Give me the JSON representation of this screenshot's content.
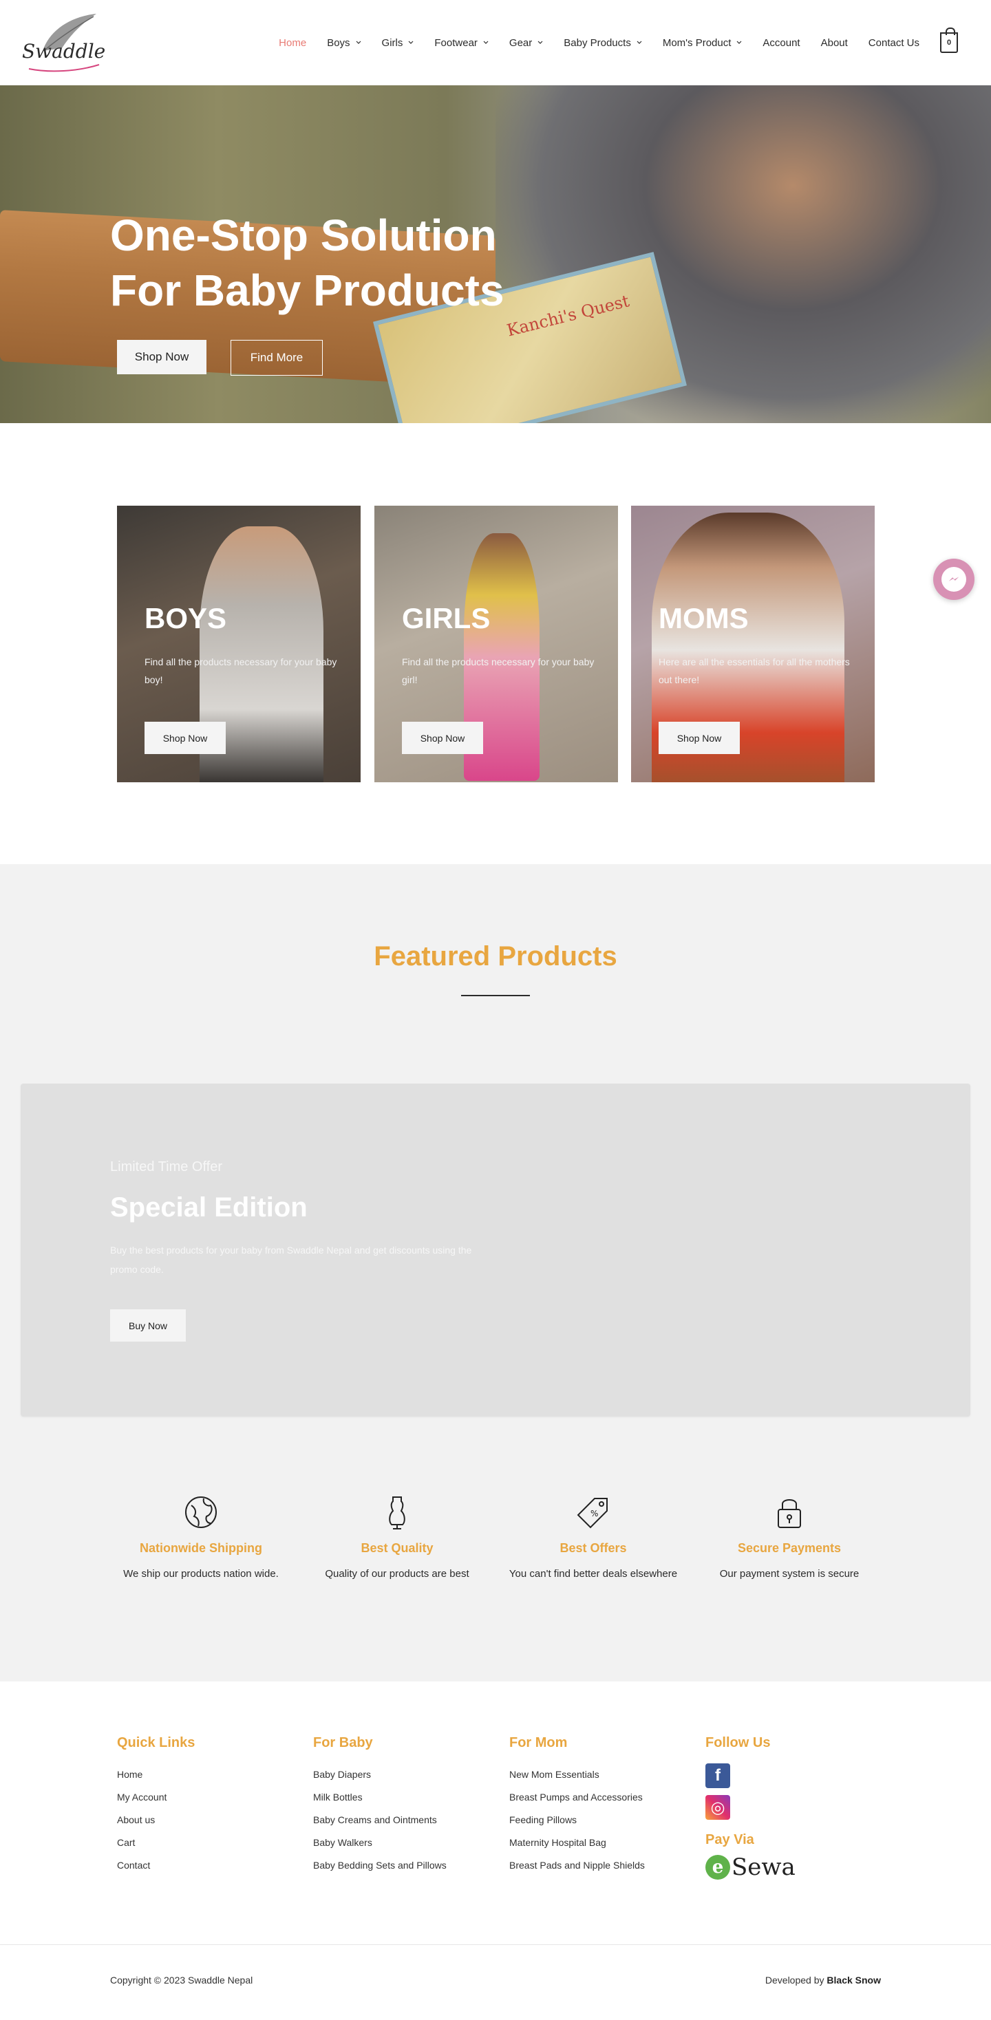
{
  "brand": {
    "logo_text": "Swaddle"
  },
  "nav": {
    "items": [
      {
        "label": "Home",
        "active": true,
        "dropdown": false
      },
      {
        "label": "Boys",
        "dropdown": true
      },
      {
        "label": "Girls",
        "dropdown": true
      },
      {
        "label": "Footwear",
        "dropdown": true
      },
      {
        "label": "Gear",
        "dropdown": true
      },
      {
        "label": "Baby Products",
        "dropdown": true
      },
      {
        "label": "Mom's Product",
        "dropdown": true
      },
      {
        "label": "Account",
        "dropdown": false
      },
      {
        "label": "About",
        "dropdown": false
      },
      {
        "label": "Contact Us",
        "dropdown": false
      }
    ],
    "cart_count": "0"
  },
  "hero": {
    "title_line1": "One-Stop Solution",
    "title_line2": "For Baby Products",
    "book_title": "Kanchi's Quest",
    "shop_button": "Shop Now",
    "find_button": "Find More"
  },
  "categories": [
    {
      "title": "BOYS",
      "desc": "Find all the products necessary for your baby boy!",
      "button": "Shop Now"
    },
    {
      "title": "GIRLS",
      "desc": "Find all the products necessary for your baby girl!",
      "button": "Shop Now"
    },
    {
      "title": "MOMS",
      "desc": "Here are all the essentials for all the mothers out there!",
      "button": "Shop Now"
    }
  ],
  "featured": {
    "title": "Featured Products"
  },
  "offer": {
    "subtitle": "Limited Time Offer",
    "title": "Special Edition",
    "desc": "Buy the best products for your baby from Swaddle Nepal and get discounts using the promo code.",
    "button": "Buy Now"
  },
  "features": [
    {
      "icon": "globe-icon",
      "title": "Nationwide Shipping",
      "desc": "We ship our products nation wide."
    },
    {
      "icon": "dress-form-icon",
      "title": "Best Quality",
      "desc": "Quality of our products are best"
    },
    {
      "icon": "price-tag-icon",
      "title": "Best Offers",
      "desc": "You can't find better deals elsewhere"
    },
    {
      "icon": "lock-icon",
      "title": "Secure Payments",
      "desc": "Our payment system is secure"
    }
  ],
  "footer": {
    "quick_links": {
      "heading": "Quick Links",
      "items": [
        "Home",
        "My Account",
        "About us",
        "Cart",
        "Contact"
      ]
    },
    "for_baby": {
      "heading": "For Baby",
      "items": [
        "Baby Diapers",
        "Milk Bottles",
        "Baby Creams and Ointments",
        "Baby Walkers",
        "Baby Bedding Sets and Pillows"
      ]
    },
    "for_mom": {
      "heading": "For Mom",
      "items": [
        "New Mom Essentials",
        "Breast Pumps and Accessories",
        "Feeding Pillows",
        "Maternity Hospital Bag",
        "Breast Pads and Nipple Shields"
      ]
    },
    "follow": {
      "heading": "Follow Us",
      "facebook_glyph": "f",
      "instagram_glyph": "◎"
    },
    "pay": {
      "heading": "Pay Via",
      "esewa_e": "e",
      "esewa_text": "Sewa"
    },
    "copyright": "Copyright © 2023 Swaddle Nepal",
    "developed_prefix": "Developed by",
    "developed_by": "Black Snow"
  },
  "colors": {
    "accent": "#e8a640",
    "nav_active": "#e87a73",
    "messenger": "#d891b4"
  }
}
